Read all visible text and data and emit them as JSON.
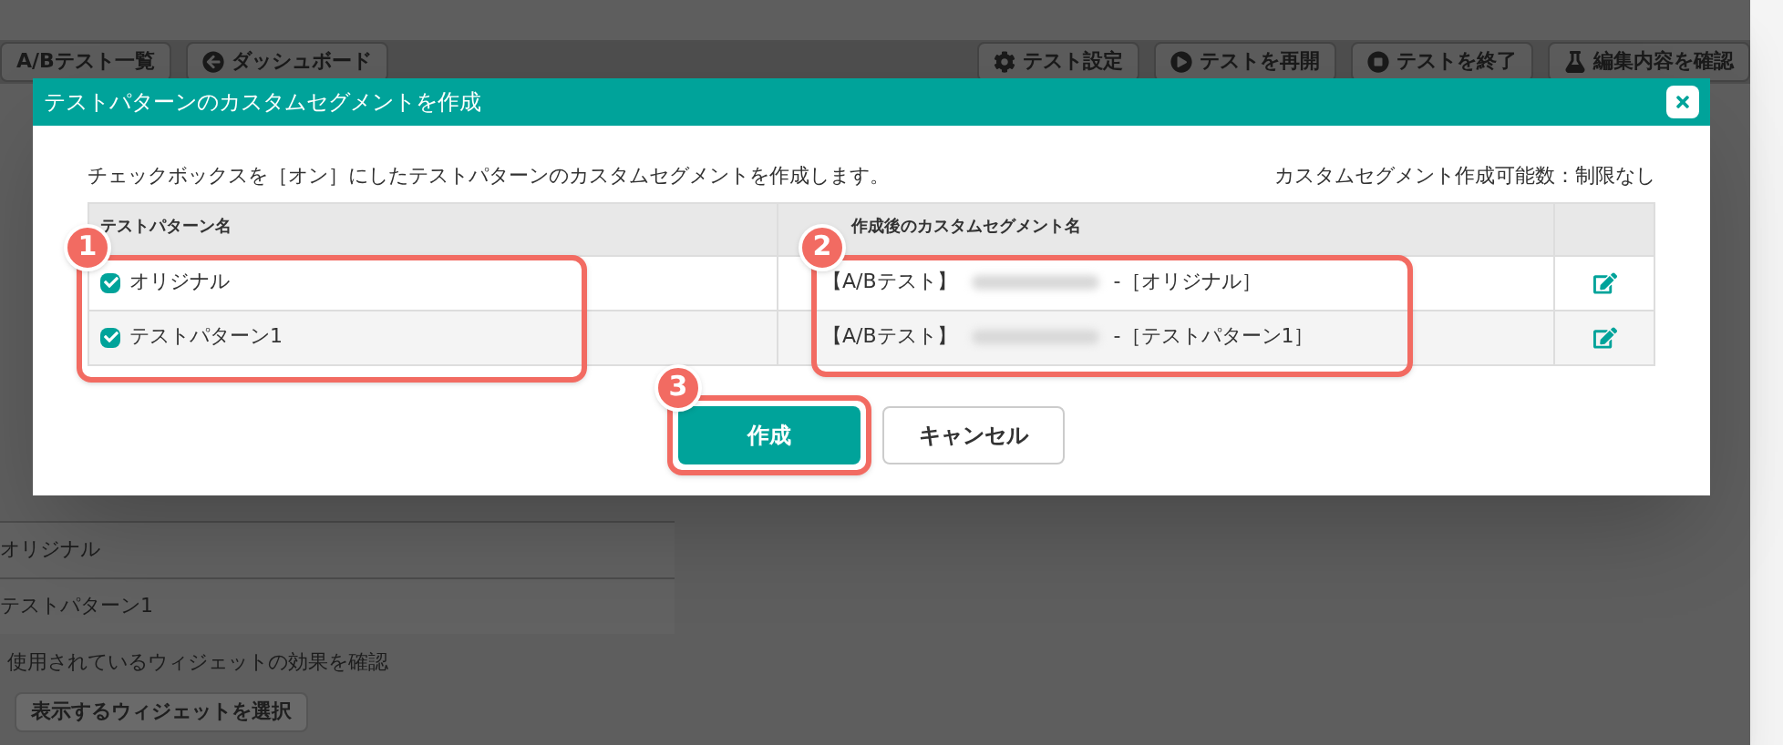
{
  "page": {
    "nav_buttons": [
      "A/Bテスト一覧",
      "ダッシュボード"
    ],
    "action_buttons": [
      "テスト設定",
      "テストを再開",
      "テストを終了",
      "編集内容を確認"
    ],
    "rows": [
      "オリジナル",
      "テストパターン1"
    ],
    "widget_label": "使用されているウィジェットの効果を確認",
    "widget_button": "表示するウィジェットを選択"
  },
  "dialog": {
    "title": "テストパターンのカスタムセグメントを作成",
    "description": "チェックボックスを［オン］にしたテストパターンのカスタムセグメントを作成します。",
    "limit": "カスタムセグメント作成可能数：制限なし",
    "columns": [
      "テストパターン名",
      "作成後のカスタムセグメント名"
    ],
    "rows": [
      {
        "pattern": "オリジナル",
        "checked": true,
        "prefix": "【A/Bテスト】",
        "suffix": "-［オリジナル］"
      },
      {
        "pattern": "テストパターン1",
        "checked": true,
        "prefix": "【A/Bテスト】",
        "suffix": "-［テストパターン1］"
      }
    ],
    "buttons": [
      {
        "label": "作成",
        "kind": "primary"
      },
      {
        "label": "キャンセル",
        "kind": "secondary"
      }
    ]
  },
  "annotations": [
    "1",
    "2",
    "3"
  ]
}
